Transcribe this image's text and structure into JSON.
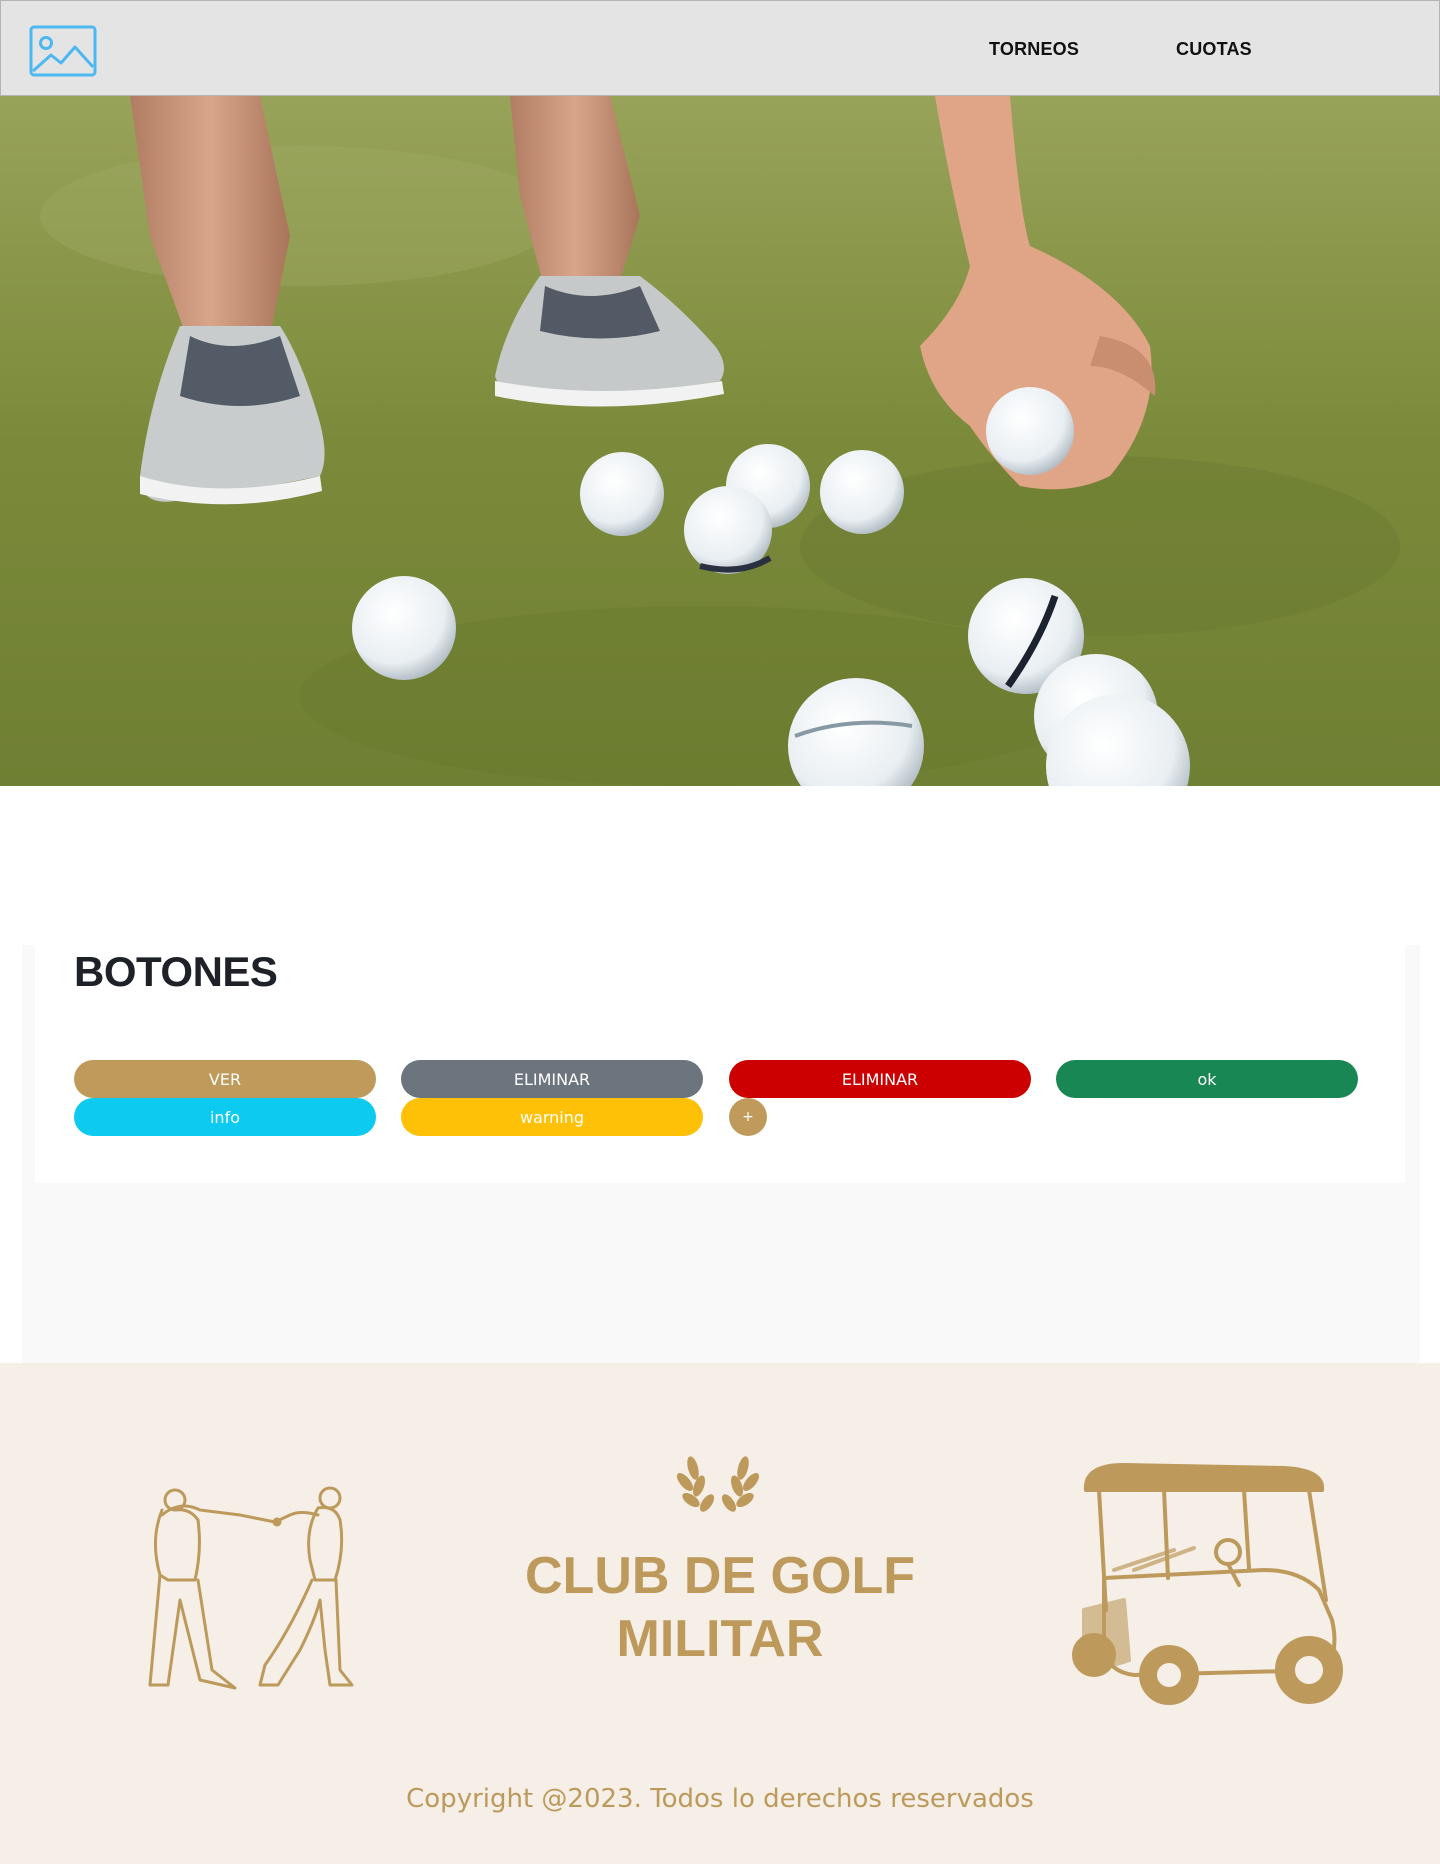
{
  "header": {
    "logo_icon": "image-placeholder-icon",
    "nav": [
      {
        "label": "TORNEOS"
      },
      {
        "label": "CUOTAS"
      }
    ]
  },
  "hero": {
    "image": "golf-balls-on-grass-photo"
  },
  "buttons_section": {
    "title": "BOTONES",
    "buttons": [
      {
        "label": "VER",
        "color": "#bf9a5b"
      },
      {
        "label": "ELIMINAR",
        "color": "#6c757d"
      },
      {
        "label": "ELIMINAR",
        "color": "#cc0000"
      },
      {
        "label": "ok",
        "color": "#198754"
      },
      {
        "label": "info",
        "color": "#0dcaf0"
      },
      {
        "label": "warning",
        "color": "#ffc107"
      },
      {
        "label": "+",
        "color": "#bf9a5b"
      }
    ]
  },
  "footer": {
    "title_line1": "CLUB DE GOLF",
    "title_line2": "MILITAR",
    "copyright": "Copyright @2023. Todos lo derechos reservados",
    "icons": [
      "golfers-illustration-icon",
      "laurel-wreath-icon",
      "golf-cart-icon"
    ],
    "accent_color": "#bd9a5c",
    "background_color": "#f5efe7"
  }
}
